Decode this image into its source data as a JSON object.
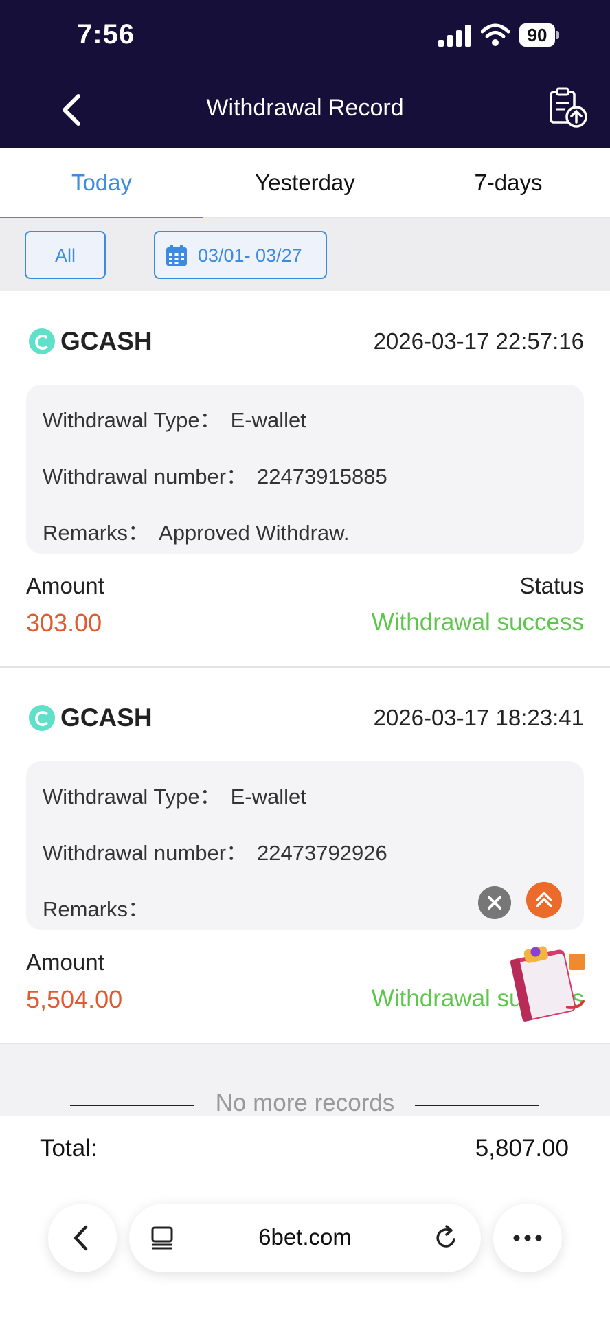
{
  "status_bar": {
    "time": "7:56",
    "battery": "90"
  },
  "header": {
    "title": "Withdrawal Record"
  },
  "tabs": [
    {
      "label": "Today",
      "active": true
    },
    {
      "label": "Yesterday",
      "active": false
    },
    {
      "label": "7-days",
      "active": false
    }
  ],
  "filters": {
    "type_label": "All",
    "date_range": "03/01- 03/27"
  },
  "labels": {
    "type": "Withdrawal Type：",
    "number": "Withdrawal number：",
    "remarks": "Remarks：",
    "amount": "Amount",
    "status": "Status"
  },
  "records": [
    {
      "provider": "GCASH",
      "datetime": "2026-03-17 22:57:16",
      "type": "E-wallet",
      "number": "22473915885",
      "remarks": "Approved Withdraw.",
      "amount": "303.00",
      "status": "Withdrawal success"
    },
    {
      "provider": "GCASH",
      "datetime": "2026-03-17 18:23:41",
      "type": "E-wallet",
      "number": "22473792926",
      "remarks": "",
      "amount": "5,504.00",
      "status": "Withdrawal success"
    }
  ],
  "footer": {
    "no_more": "No more records",
    "total_label": "Total:",
    "total_value": "5,807.00"
  },
  "browser": {
    "url": "6bet.com"
  },
  "colors": {
    "header_bg": "#150f3a",
    "accent": "#3d8be0",
    "amount": "#e05a32",
    "success": "#5cc74b"
  },
  "icons": [
    "back-icon",
    "upload-record-icon",
    "calendar-icon",
    "gcash-logo",
    "close-icon",
    "scroll-top-icon",
    "gift-icon",
    "tabs-icon",
    "reload-icon",
    "more-icon"
  ]
}
